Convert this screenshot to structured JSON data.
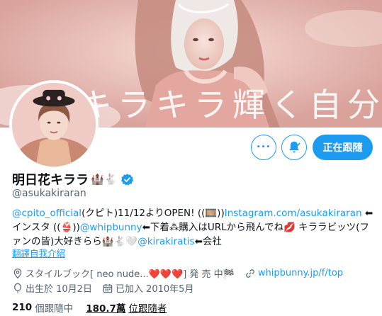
{
  "banner": {
    "text": "キラキラ輝く自分へ"
  },
  "actions": {
    "more_glyph": "•••",
    "following_label": "正在跟隨"
  },
  "profile": {
    "name": "明日花キララ",
    "name_emojis": "🏰🐇",
    "handle": "@asukakiraran",
    "bio": {
      "seg1_link": "@cpito_official",
      "seg2": "(クピト)11/12よりOPEN! ((🎞️))",
      "seg3_link": "Instagram.com/asukakiraran",
      "seg4": " ⬅インスタ ((👙))",
      "seg5_link": "@whipbunny",
      "seg6": "⬅下着⁂購入はURLから飛んでね💋 キララビッツ(ファンの皆)大好きらら🏰🐇🤍",
      "seg7_link": "@kirakiratis",
      "seg8": "⬅会社"
    },
    "translate_label": "翻譯自我介紹",
    "location": "スタイルブック[ neo nude...❤️❤️❤️] 発 売 中🏁",
    "website": "whipbunny.jp/f/top",
    "birthday": "出生於 10月2日",
    "joined": "已加入 2010年5月"
  },
  "stats": {
    "following_count": "210",
    "following_label": "個跟隨中",
    "followers_count": "180.7萬",
    "followers_label": "位跟隨者"
  },
  "colors": {
    "accent": "#1d9bf0",
    "text": "#0f1419",
    "secondary": "#536471",
    "banner_pink": "#e8b8b2"
  },
  "icons": {
    "more": "more-icon",
    "bell": "notification-bell-icon",
    "verified": "verified-badge-icon",
    "location": "location-pin-icon",
    "link": "link-icon",
    "birthday": "balloon-icon",
    "calendar": "calendar-icon"
  }
}
